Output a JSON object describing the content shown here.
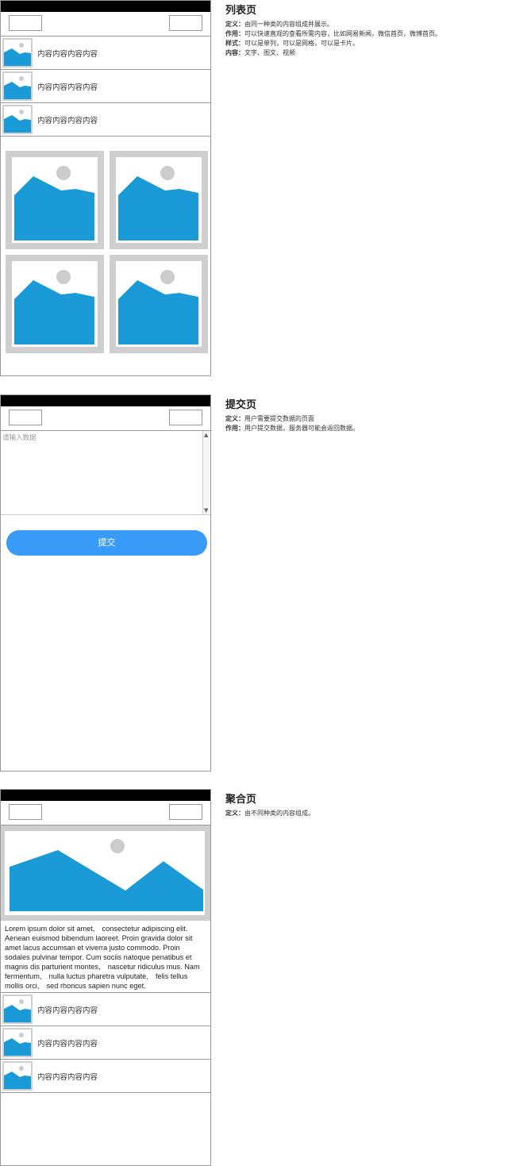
{
  "list_page": {
    "title": "列表页",
    "definition_label": "定义：",
    "definition": "由同一种类的内容组成并展示。",
    "purpose_label": "作用：",
    "purpose": "可以快速直观的查看所需内容，比如网易新闻，微信首页，微博首页。",
    "style_label": "样式：",
    "style": "可以是单列，可以是网格，可以是卡片。",
    "content_label": "内容：",
    "content": "文字、图文、视频",
    "list_items": [
      "内容内容内容内容",
      "内容内容内容内容",
      "内容内容内容内容"
    ]
  },
  "submit_page": {
    "title": "提交页",
    "definition_label": "定义：",
    "definition": "用户需要提交数据的页面",
    "purpose_label": "作用：",
    "purpose": "用户提交数据，服务器可能会返回数据。",
    "input_placeholder": "请输入数据",
    "submit_label": "提交"
  },
  "aggregate_page": {
    "title": "聚合页",
    "definition_label": "定义：",
    "definition": "由不同种类的内容组成。",
    "body_text": "Lorem ipsum dolor sit amet,　consectetur adipiscing elit. Aenean euismod bibendum laoreet. Proin gravida dolor sit amet lacus accumsan et viverra justo commodo. Proin sodales pulvinar tempor. Cum sociis natoque penatibus et magnis dis parturient montes,　nascetur ridiculus mus. Nam fermentum,　nulla luctus pharetra vulputate,　felis tellus mollis orci,　sed rhoncus sapien nunc eget.",
    "list_items": [
      "内容内容内容内容",
      "内容内容内容内容",
      "内容内容内容内容"
    ]
  },
  "colors": {
    "image_fill": "#1a9ad6",
    "image_frame": "#cfcfcf",
    "sun": "#cccccc",
    "button": "#3a9af7",
    "statusbar": "#000000"
  }
}
